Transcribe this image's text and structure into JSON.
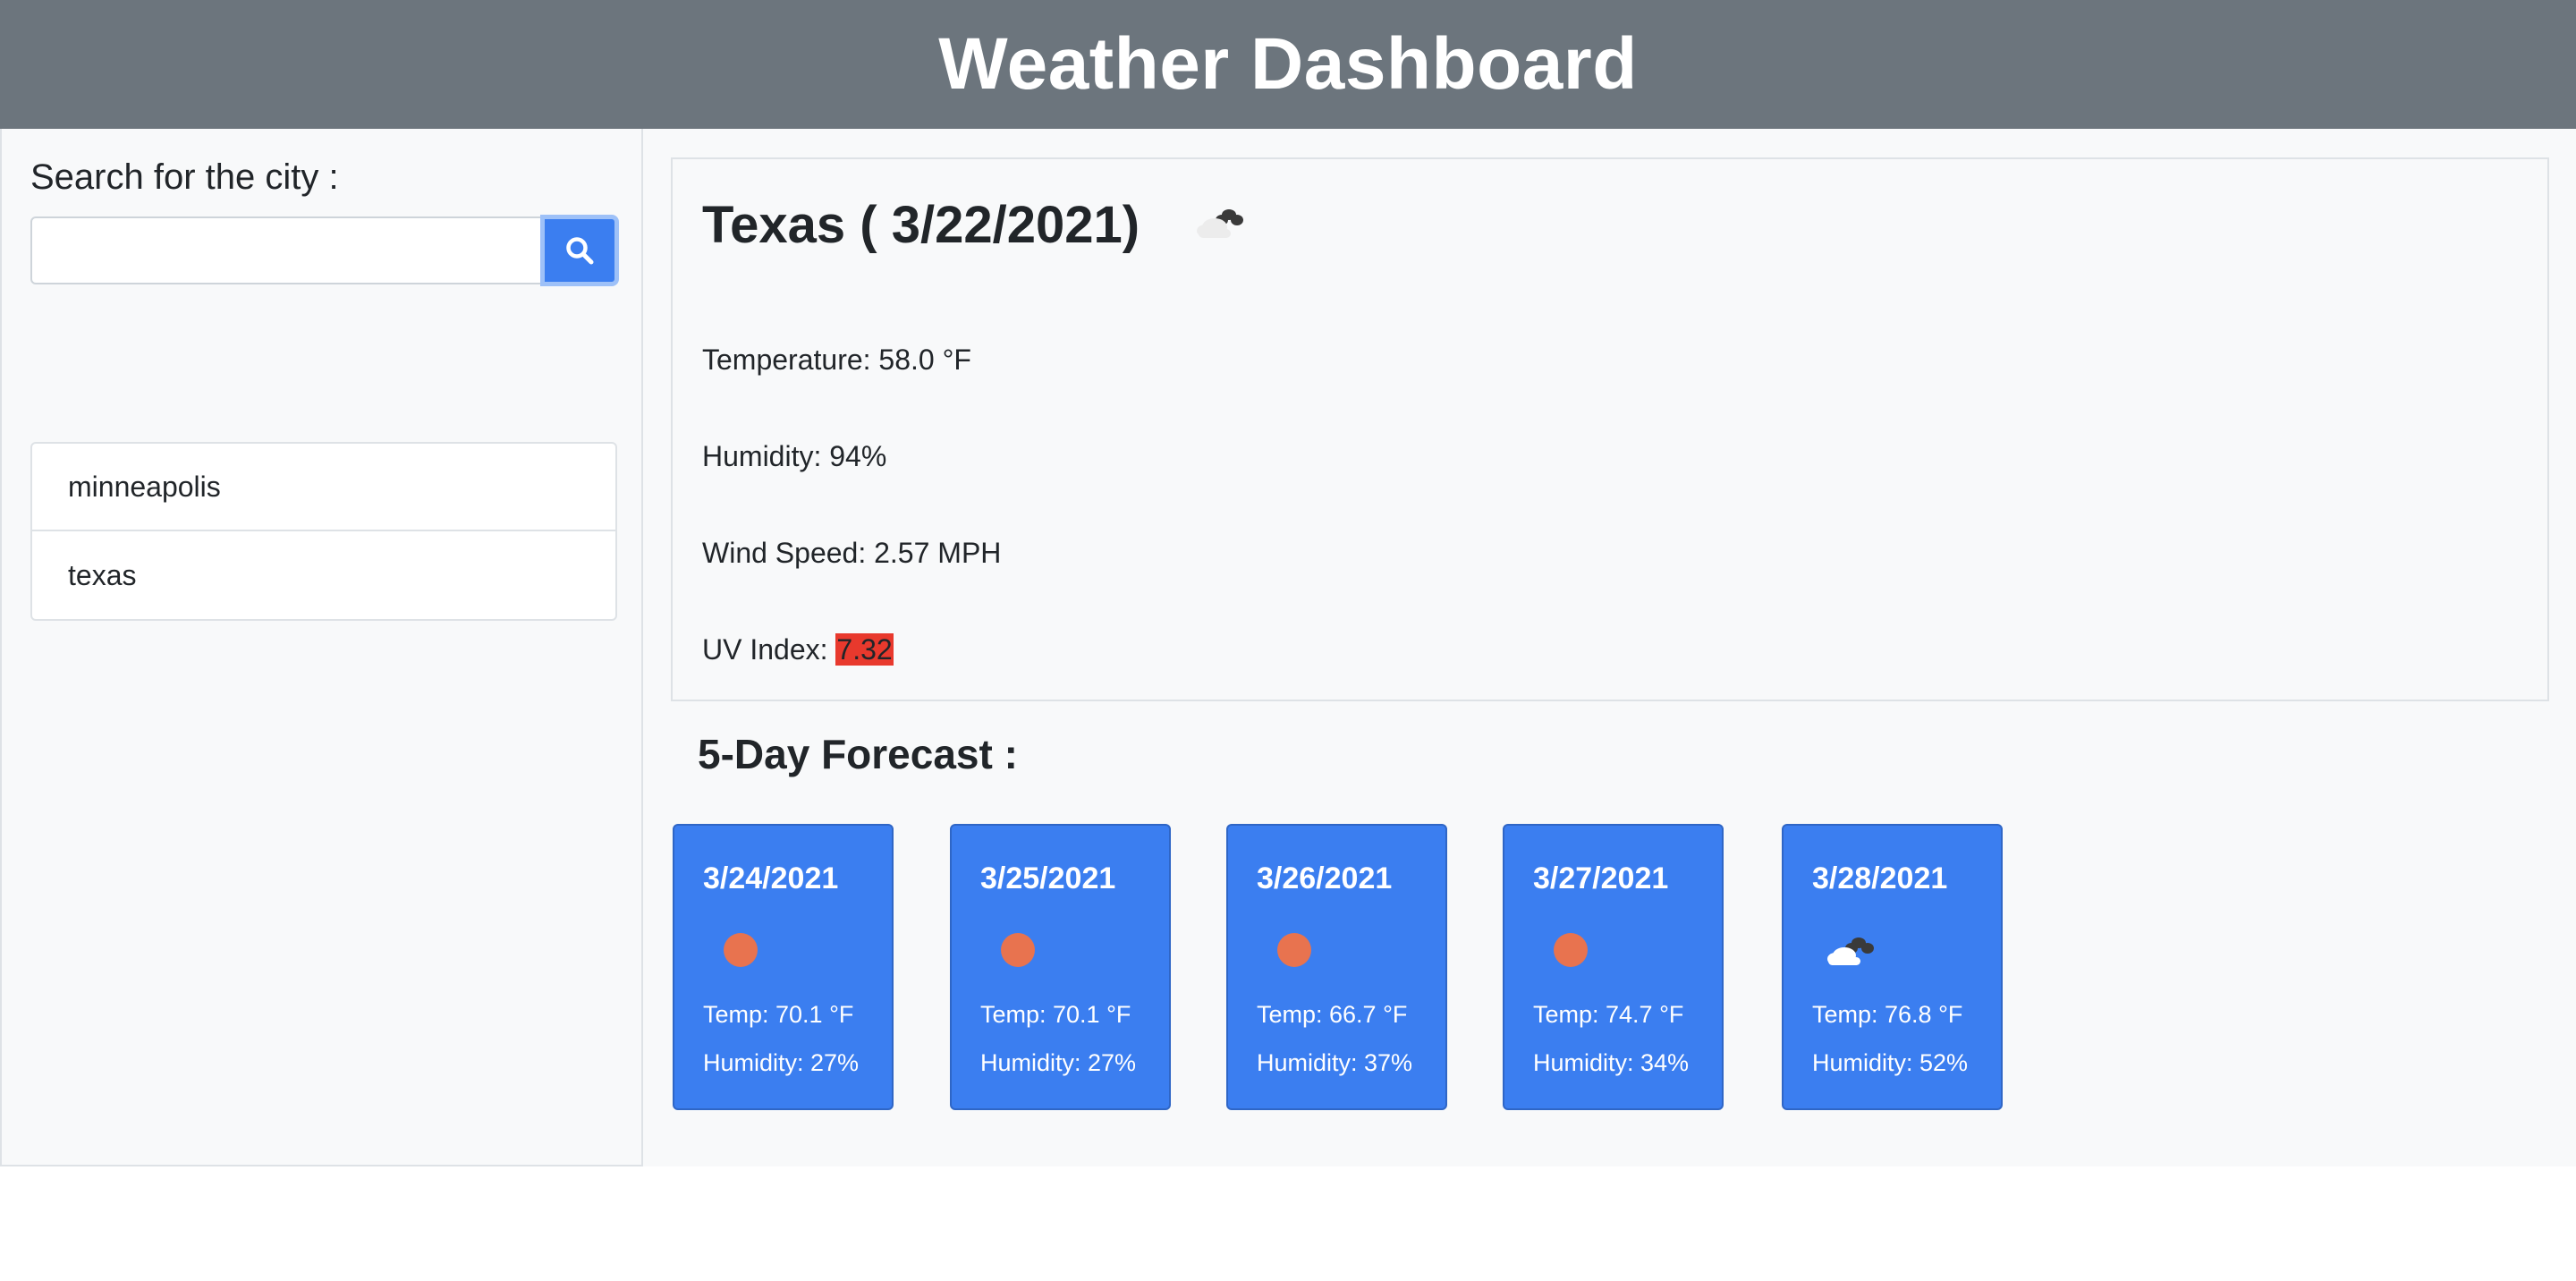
{
  "header": {
    "title": "Weather Dashboard"
  },
  "sidebar": {
    "search_label": "Search for the city :",
    "search_value": "",
    "search_placeholder": "",
    "search_button_icon": "search-icon",
    "cities": [
      "minneapolis",
      "texas"
    ]
  },
  "current": {
    "title": "Texas ( 3/22/2021)",
    "icon": "cloud-icon",
    "temperature": "Temperature: 58.0 °F",
    "humidity": "Humidity: 94%",
    "wind": "Wind Speed: 2.57 MPH",
    "uv_label": "UV Index: ",
    "uv_value": "7.32",
    "uv_color": "#e8392d"
  },
  "forecast": {
    "title": "5-Day Forecast :",
    "card_color": "#3b7ef0",
    "days": [
      {
        "date": "3/24/2021",
        "icon": "sun-icon",
        "temp": "Temp: 70.1 °F",
        "humidity": "Humidity: 27%"
      },
      {
        "date": "3/25/2021",
        "icon": "sun-icon",
        "temp": "Temp: 70.1 °F",
        "humidity": "Humidity: 27%"
      },
      {
        "date": "3/26/2021",
        "icon": "sun-icon",
        "temp": "Temp: 66.7 °F",
        "humidity": "Humidity: 37%"
      },
      {
        "date": "3/27/2021",
        "icon": "sun-icon",
        "temp": "Temp: 74.7 °F",
        "humidity": "Humidity: 34%"
      },
      {
        "date": "3/28/2021",
        "icon": "cloud-icon",
        "temp": "Temp: 76.8 °F",
        "humidity": "Humidity: 52%"
      }
    ]
  }
}
